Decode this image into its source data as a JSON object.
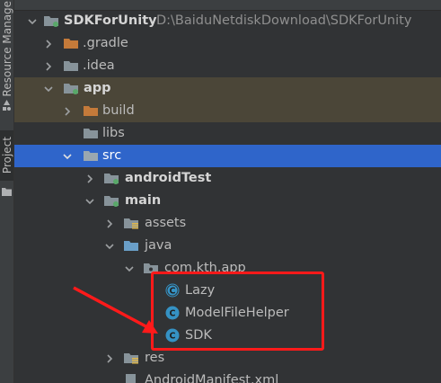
{
  "sidebar": {
    "tabs": [
      {
        "label": "Resource Manager",
        "active": false
      },
      {
        "label": "Project",
        "active": true
      }
    ]
  },
  "tree": {
    "root": {
      "label": "SDKForUnity",
      "path": "D:\\BaiduNetdiskDownload\\SDKForUnity"
    },
    "items": [
      {
        "label": ".gradle",
        "icon": "folder-icon",
        "expanded": false,
        "highlight": "none"
      },
      {
        "label": ".idea",
        "icon": "folder-icon",
        "expanded": false,
        "highlight": "none"
      },
      {
        "label": "app",
        "icon": "module-folder-icon",
        "expanded": true,
        "highlight": "brown"
      },
      {
        "label": "build",
        "icon": "excluded-folder-icon",
        "expanded": false,
        "highlight": "brown"
      },
      {
        "label": "libs",
        "icon": "folder-icon",
        "expanded": null,
        "highlight": "none"
      },
      {
        "label": "src",
        "icon": "folder-icon",
        "expanded": true,
        "highlight": "selected"
      },
      {
        "label": "androidTest",
        "icon": "source-set-folder-icon",
        "expanded": false,
        "highlight": "none"
      },
      {
        "label": "main",
        "icon": "source-set-folder-icon",
        "expanded": true,
        "highlight": "none"
      },
      {
        "label": "assets",
        "icon": "resource-folder-icon",
        "expanded": false,
        "highlight": "none"
      },
      {
        "label": "java",
        "icon": "source-folder-icon",
        "expanded": true,
        "highlight": "none"
      },
      {
        "label": "com.kth.app",
        "icon": "package-icon",
        "expanded": true,
        "highlight": "none"
      },
      {
        "label": "Lazy",
        "icon": "abstract-class-icon",
        "expanded": null,
        "highlight": "none"
      },
      {
        "label": "ModelFileHelper",
        "icon": "class-icon",
        "expanded": null,
        "highlight": "none"
      },
      {
        "label": "SDK",
        "icon": "class-icon",
        "expanded": null,
        "highlight": "none"
      },
      {
        "label": "res",
        "icon": "resource-folder-icon",
        "expanded": false,
        "highlight": "none"
      },
      {
        "label": "AndroidManifest.xml",
        "icon": "xml-file-icon",
        "expanded": null,
        "highlight": "none"
      }
    ]
  },
  "annotation": {
    "box_color": "#ff1a1a",
    "arrow_color": "#ff1a1a"
  },
  "colors": {
    "background": "#2b2b2b",
    "selection": "#2f65ca",
    "brown_highlight": "#4b4638",
    "folder": "#87939a",
    "excluded_folder": "#c47a3a",
    "module_dot": "#59a869",
    "class_icon": "#3592c4"
  }
}
